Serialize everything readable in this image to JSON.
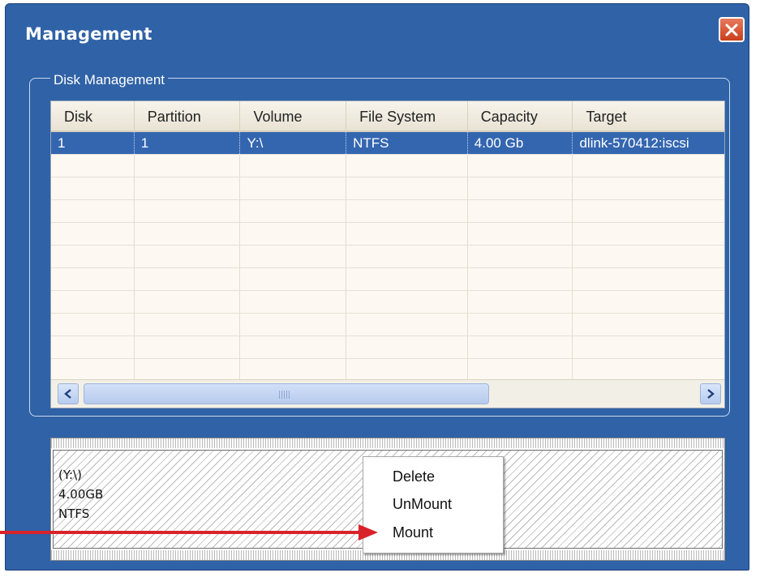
{
  "window": {
    "title": "Management",
    "close_icon": "close-icon"
  },
  "group": {
    "label": "Disk Management"
  },
  "table": {
    "columns": [
      "Disk",
      "Partition",
      "Volume",
      "File System",
      "Capacity",
      "Target"
    ],
    "rows": [
      [
        "1",
        "1",
        "Y:\\",
        "NTFS",
        "4.00 Gb",
        "dlink-570412:iscsi"
      ]
    ],
    "selected_row": 0
  },
  "scrollbar": {
    "left_icon": "chevron-left-icon",
    "right_icon": "chevron-right-icon"
  },
  "partition": {
    "volume": "(Y:\\)",
    "size": "4.00GB",
    "fs": "NTFS"
  },
  "context_menu": {
    "items": [
      "Delete",
      "UnMount",
      "Mount"
    ]
  },
  "colors": {
    "window_bg": "#2f62a6",
    "selected_row": "#3466b0",
    "annotation_arrow": "#d9232a"
  }
}
